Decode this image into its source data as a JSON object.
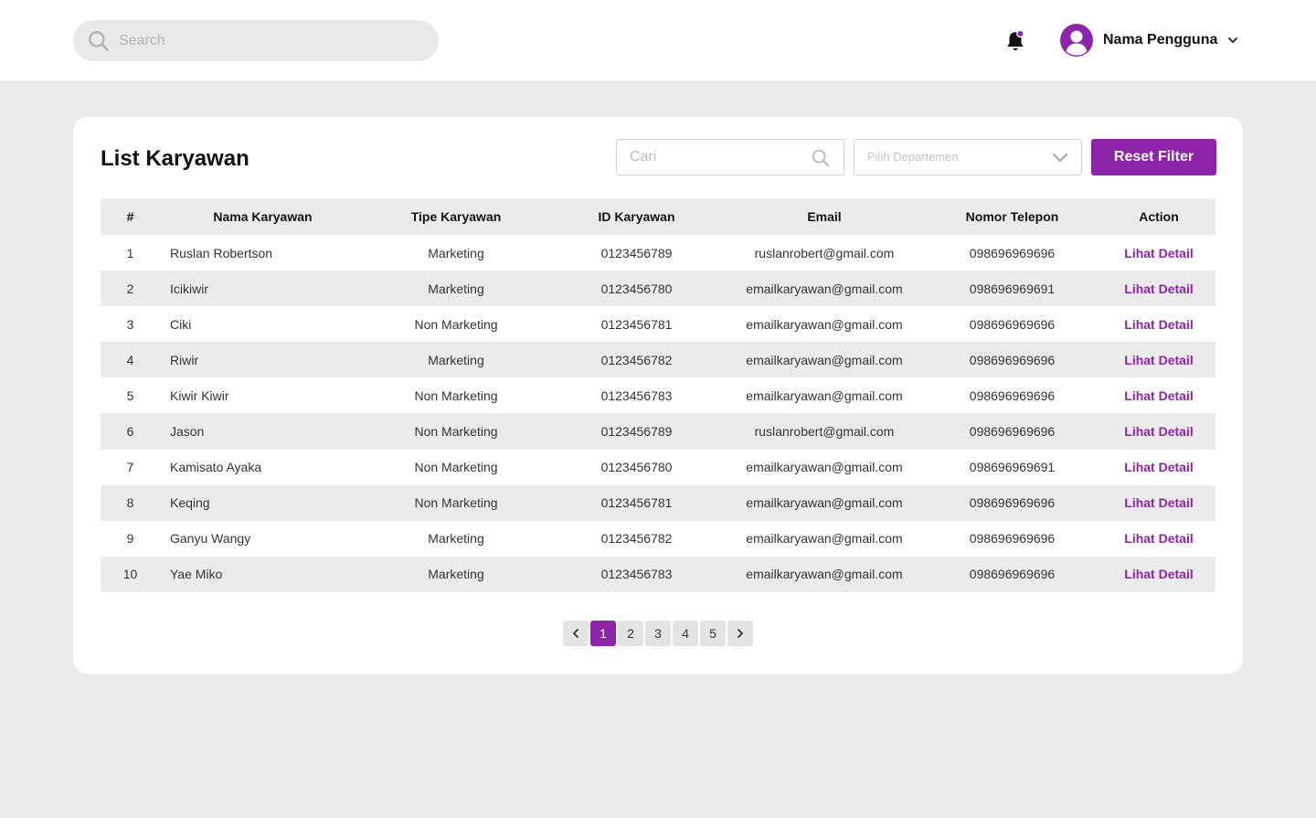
{
  "header": {
    "search_placeholder": "Search",
    "user_name": "Nama Pengguna"
  },
  "main": {
    "title": "List Karyawan",
    "filter_placeholder": "Cari",
    "department_placeholder": "Pilih Departemen",
    "reset_label": "Reset Filter"
  },
  "table": {
    "columns": [
      "#",
      "Nama Karyawan",
      "Tipe Karyawan",
      "ID Karyawan",
      "Email",
      "Nomor Telepon",
      "Action"
    ],
    "rows": [
      {
        "no": "1",
        "name": "Ruslan Robertson",
        "type": "Marketing",
        "id": "0123456789",
        "email": "ruslanrobert@gmail.com",
        "phone": "098696969696",
        "action": "Lihat Detail"
      },
      {
        "no": "2",
        "name": "Icikiwir",
        "type": "Marketing",
        "id": "0123456780",
        "email": "emailkaryawan@gmail.com",
        "phone": "098696969691",
        "action": "Lihat Detail"
      },
      {
        "no": "3",
        "name": "Ciki",
        "type": "Non Marketing",
        "id": "0123456781",
        "email": "emailkaryawan@gmail.com",
        "phone": "098696969696",
        "action": "Lihat Detail"
      },
      {
        "no": "4",
        "name": "Riwir",
        "type": "Marketing",
        "id": "0123456782",
        "email": "emailkaryawan@gmail.com",
        "phone": "098696969696",
        "action": "Lihat Detail"
      },
      {
        "no": "5",
        "name": "Kiwir Kiwir",
        "type": "Non Marketing",
        "id": "0123456783",
        "email": "emailkaryawan@gmail.com",
        "phone": "098696969696",
        "action": "Lihat Detail"
      },
      {
        "no": "6",
        "name": "Jason",
        "type": "Non Marketing",
        "id": "0123456789",
        "email": "ruslanrobert@gmail.com",
        "phone": "098696969696",
        "action": "Lihat Detail"
      },
      {
        "no": "7",
        "name": "Kamisato Ayaka",
        "type": "Non Marketing",
        "id": "0123456780",
        "email": "emailkaryawan@gmail.com",
        "phone": "098696969691",
        "action": "Lihat Detail"
      },
      {
        "no": "8",
        "name": "Keqing",
        "type": "Non Marketing",
        "id": "0123456781",
        "email": "emailkaryawan@gmail.com",
        "phone": "098696969696",
        "action": "Lihat Detail"
      },
      {
        "no": "9",
        "name": "Ganyu Wangy",
        "type": "Marketing",
        "id": "0123456782",
        "email": "emailkaryawan@gmail.com",
        "phone": "098696969696",
        "action": "Lihat Detail"
      },
      {
        "no": "10",
        "name": "Yae Miko",
        "type": "Marketing",
        "id": "0123456783",
        "email": "emailkaryawan@gmail.com",
        "phone": "098696969696",
        "action": "Lihat Detail"
      }
    ]
  },
  "pagination": {
    "pages": [
      "1",
      "2",
      "3",
      "4",
      "5"
    ],
    "current": "1"
  },
  "icons": {
    "search": "search-icon",
    "bell": "bell-icon",
    "avatar": "user-avatar-icon",
    "dropdown": "chevron-down-icon",
    "prev": "chevron-left-icon",
    "next": "chevron-right-icon"
  },
  "colors": {
    "accent": "#8e24aa",
    "background": "#ebebeb",
    "card": "#ffffff"
  }
}
